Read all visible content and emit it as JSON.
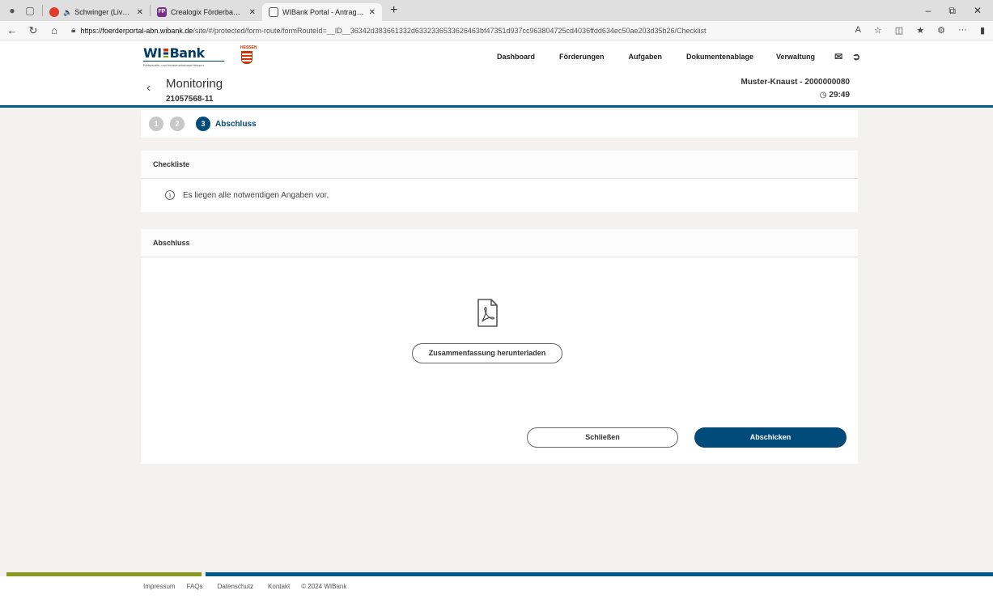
{
  "browser": {
    "tabs": [
      {
        "title": "Schwinger (Live Berlin Wuhl",
        "active": false,
        "favicon_color": "#e23b2e"
      },
      {
        "title": "Crealogix Förderbanken Portal -",
        "active": false,
        "favicon_color": "#7b2d8e",
        "favicon_text": "FP"
      },
      {
        "title": "WIBank Portal - Antragsstrecke -",
        "active": true,
        "favicon_color": "#ffffff"
      }
    ],
    "url_host": "https://foerderportal-abn.wibank.de",
    "url_path": "/site/#/protected/form-route/formRouteId=__ID__36342d383661332d6332336533626463bf47351d937cc963804725cd4036ffdd634ec50ae203d35b26/Checklist"
  },
  "header": {
    "logo_text": "WI",
    "logo_text2": "Bank",
    "logo_tagline": "Wirtschafts- und Infrastrukturbank Hessen",
    "hessen_text": "HESSEN",
    "nav": [
      "Dashboard",
      "Förderungen",
      "Aufgaben",
      "Dokumentenablage",
      "Verwaltung"
    ],
    "page_title": "Monitoring",
    "page_subtitle": "21057568-11",
    "account": "Muster-Knaust - 2000000080",
    "timer": "29:49"
  },
  "stepper": {
    "steps": [
      "1",
      "2",
      "3"
    ],
    "active_label": "Abschluss"
  },
  "checklist": {
    "title": "Checkliste",
    "info": "Es liegen alle notwendigen Angaben vor."
  },
  "abschluss": {
    "title": "Abschluss",
    "download_label": "Zusammenfassung herunterladen",
    "close_label": "Schließen",
    "submit_label": "Abschicken"
  },
  "footer": {
    "links": [
      "Impressum",
      "FAQs",
      "Datenschutz",
      "Kontakt"
    ],
    "copyright": "© 2024 WIBank"
  },
  "colors": {
    "primary": "#004b7a",
    "accent_green": "#8a9a1e"
  }
}
